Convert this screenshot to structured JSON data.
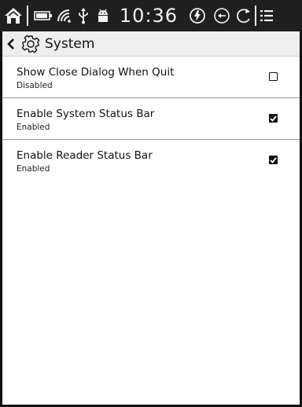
{
  "status_bar": {
    "time": "10:36",
    "icons": [
      "home-icon",
      "battery-icon",
      "wifi-icon",
      "usb-icon",
      "android-icon",
      "refresh-mode-icon",
      "back-circle-icon",
      "rotate-icon",
      "menu-icon"
    ]
  },
  "header": {
    "back_icon": "chevron-left-icon",
    "settings_icon": "gear-icon",
    "title": "System"
  },
  "settings": [
    {
      "label": "Show Close Dialog When Quit",
      "status": "Disabled",
      "checked": false
    },
    {
      "label": "Enable System Status Bar",
      "status": "Enabled",
      "checked": true
    },
    {
      "label": "Enable Reader Status Bar",
      "status": "Enabled",
      "checked": true
    }
  ]
}
